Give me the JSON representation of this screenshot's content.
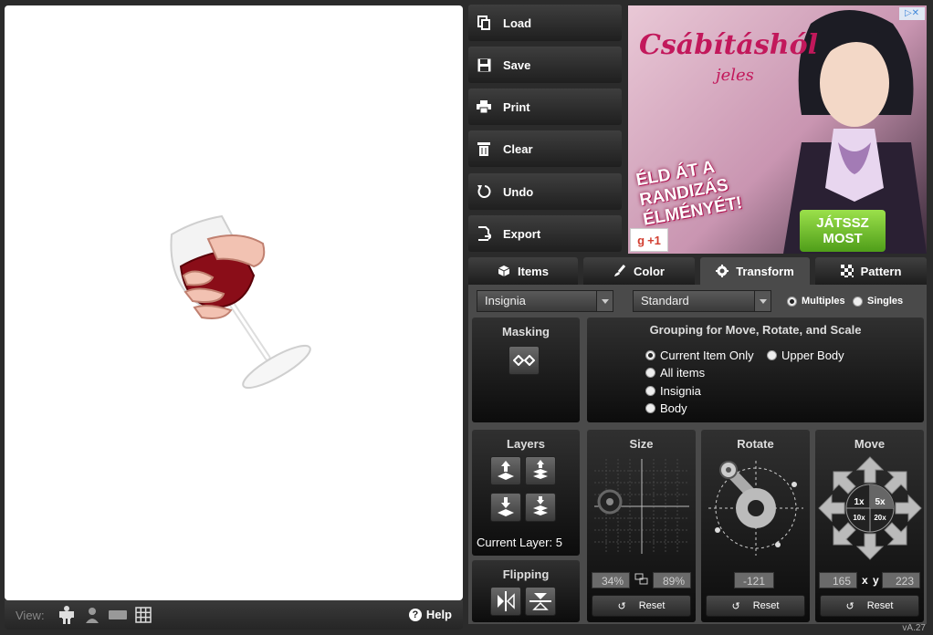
{
  "actions": [
    {
      "label": "Load",
      "icon": "copy-icon"
    },
    {
      "label": "Save",
      "icon": "floppy-icon"
    },
    {
      "label": "Print",
      "icon": "printer-icon"
    },
    {
      "label": "Clear",
      "icon": "trash-icon"
    },
    {
      "label": "Undo",
      "icon": "undo-icon"
    },
    {
      "label": "Export",
      "icon": "export-icon"
    }
  ],
  "ad": {
    "logo": "Csábításhól",
    "logo_sub": "jeles",
    "headline": "ÉLD ÁT A RANDIZÁS ÉLMÉNYÉT!",
    "cta_line1": "JÁTSSZ",
    "cta_line2": "MOST",
    "gplus": "+1"
  },
  "tabs": [
    {
      "label": "Items",
      "icon": "cube-icon"
    },
    {
      "label": "Color",
      "icon": "brush-icon"
    },
    {
      "label": "Transform",
      "icon": "gear-icon"
    },
    {
      "label": "Pattern",
      "icon": "checker-icon"
    }
  ],
  "controls": {
    "item_select": "Insignia",
    "mode_select": "Standard",
    "multiples_label": "Multiples",
    "singles_label": "Singles"
  },
  "masking": {
    "title": "Masking"
  },
  "grouping": {
    "title": "Grouping for Move, Rotate, and Scale",
    "options": [
      "Current Item Only",
      "Upper Body",
      "All items",
      "Insignia",
      "Body"
    ]
  },
  "layers": {
    "title": "Layers",
    "current_label": "Current Layer:",
    "current_value": "5"
  },
  "flipping": {
    "title": "Flipping"
  },
  "size": {
    "title": "Size",
    "width": "34",
    "height": "89",
    "unit": "%",
    "reset": "Reset"
  },
  "rotate": {
    "title": "Rotate",
    "value": "-121",
    "reset": "Reset"
  },
  "move": {
    "title": "Move",
    "x": "165",
    "y": "223",
    "x_sep": "x",
    "y_label": "y",
    "steps": [
      "1x",
      "5x",
      "10x",
      "20x"
    ],
    "reset": "Reset"
  },
  "viewbar": {
    "label": "View:",
    "help": "Help"
  },
  "version": "vA.27"
}
